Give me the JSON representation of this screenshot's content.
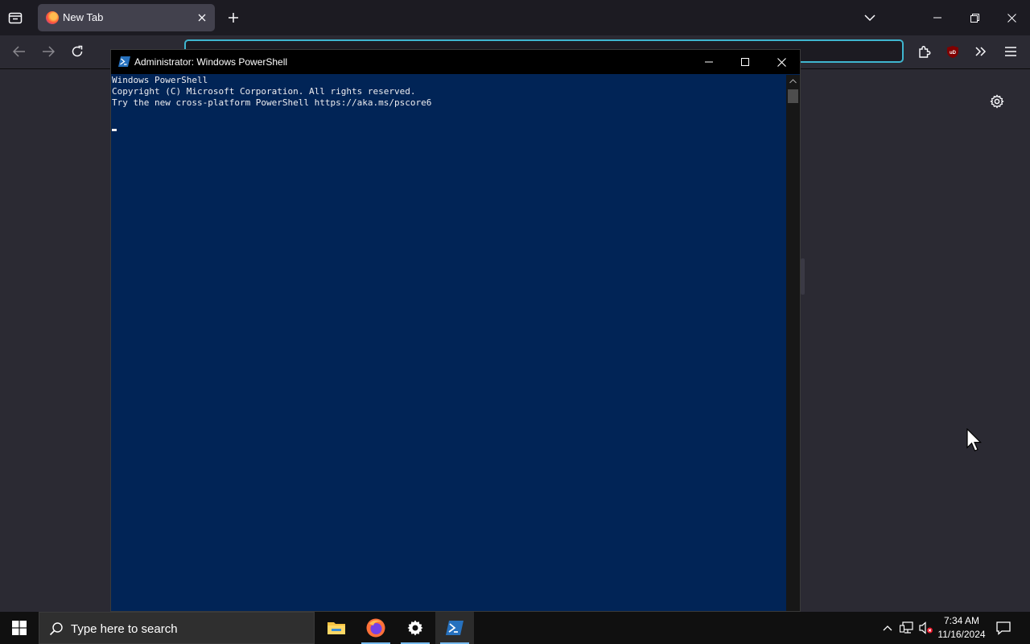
{
  "browser": {
    "tab": {
      "title": "New Tab"
    },
    "urlbar": {
      "placeholder": ""
    }
  },
  "powershell": {
    "window_title": "Administrator: Windows PowerShell",
    "console_lines": [
      "Windows PowerShell",
      "Copyright (C) Microsoft Corporation. All rights reserved.",
      "",
      "Try the new cross-platform PowerShell https://aka.ms/pscore6"
    ]
  },
  "taskbar": {
    "search_placeholder": "Type here to search",
    "time": "7:34 AM",
    "date": "11/16/2024",
    "apps": [
      "file-explorer",
      "firefox",
      "settings",
      "powershell"
    ]
  },
  "colors": {
    "console_bg": "#012456",
    "console_fg": "#eeedf0",
    "url_focus": "#3fb6cf",
    "taskbar_indicator": "#76b9ed"
  }
}
